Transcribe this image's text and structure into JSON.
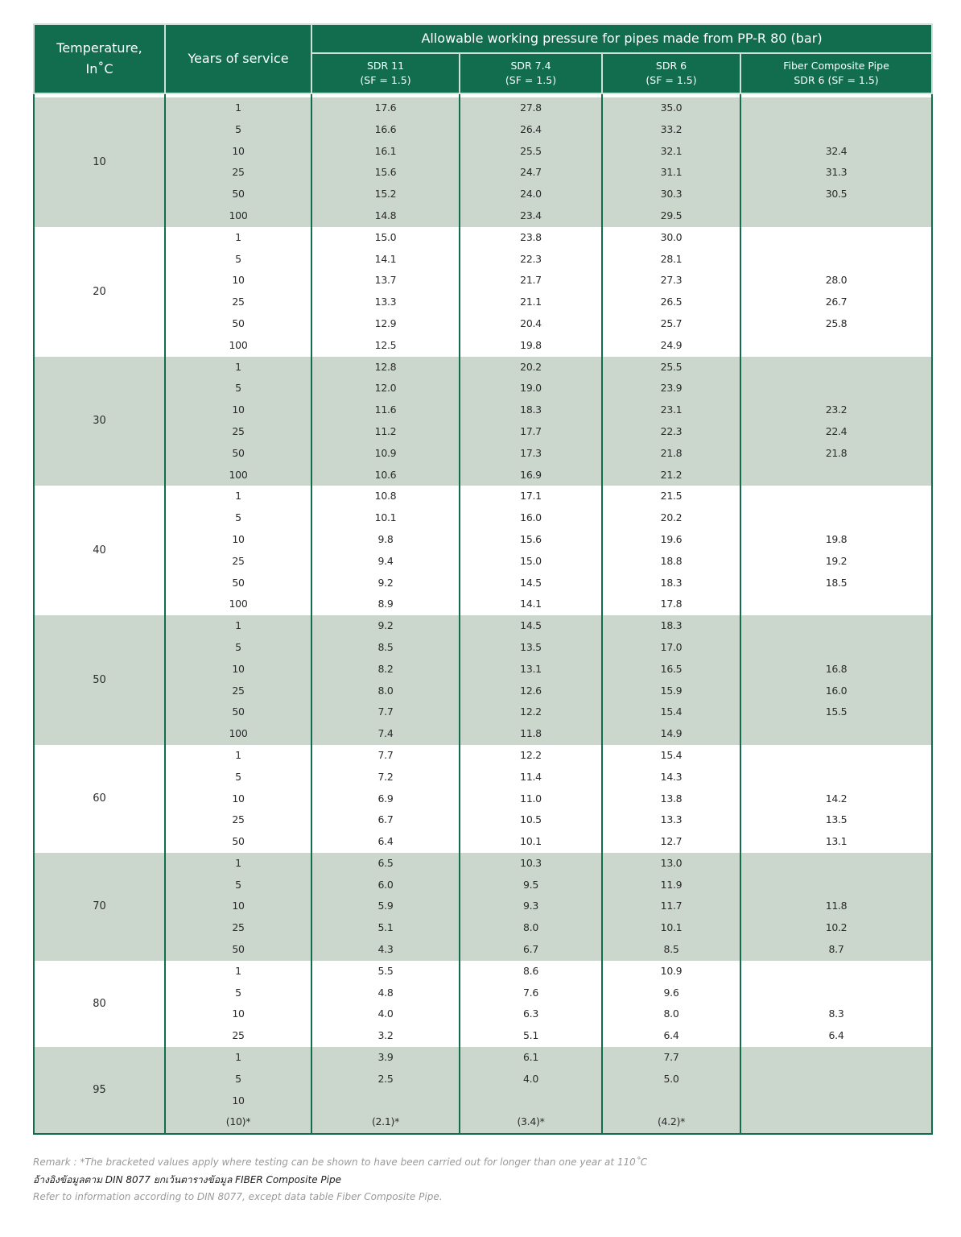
{
  "header": {
    "temperature_label_line1": "Temperature,",
    "temperature_label_line2": "In˚C",
    "years_label": "Years of service",
    "group_title": "Allowable working pressure for pipes made from PP-R 80 (bar)",
    "columns": [
      {
        "line1": "SDR 11",
        "line2": "(SF = 1.5)"
      },
      {
        "line1": "SDR 7.4",
        "line2": "(SF = 1.5)"
      },
      {
        "line1": "SDR 6",
        "line2": "(SF = 1.5)"
      },
      {
        "line1": "Fiber Composite Pipe",
        "line2": "SDR 6 (SF = 1.5)"
      }
    ]
  },
  "colors": {
    "header_green": "#116d4e",
    "row_shade": "#cbd7cd"
  },
  "groups": [
    {
      "temp": "10",
      "years": [
        "1",
        "5",
        "10",
        "25",
        "50",
        "100"
      ],
      "sdr11": [
        "17.6",
        "16.6",
        "16.1",
        "15.6",
        "15.2",
        "14.8"
      ],
      "sdr74": [
        "27.8",
        "26.4",
        "25.5",
        "24.7",
        "24.0",
        "23.4"
      ],
      "sdr6": [
        "35.0",
        "33.2",
        "32.1",
        "31.1",
        "30.3",
        "29.5"
      ],
      "fiber": [
        "",
        "",
        "32.4",
        "31.3",
        "30.5",
        ""
      ]
    },
    {
      "temp": "20",
      "years": [
        "1",
        "5",
        "10",
        "25",
        "50",
        "100"
      ],
      "sdr11": [
        "15.0",
        "14.1",
        "13.7",
        "13.3",
        "12.9",
        "12.5"
      ],
      "sdr74": [
        "23.8",
        "22.3",
        "21.7",
        "21.1",
        "20.4",
        "19.8"
      ],
      "sdr6": [
        "30.0",
        "28.1",
        "27.3",
        "26.5",
        "25.7",
        "24.9"
      ],
      "fiber": [
        "",
        "",
        "28.0",
        "26.7",
        "25.8",
        ""
      ]
    },
    {
      "temp": "30",
      "years": [
        "1",
        "5",
        "10",
        "25",
        "50",
        "100"
      ],
      "sdr11": [
        "12.8",
        "12.0",
        "11.6",
        "11.2",
        "10.9",
        "10.6"
      ],
      "sdr74": [
        "20.2",
        "19.0",
        "18.3",
        "17.7",
        "17.3",
        "16.9"
      ],
      "sdr6": [
        "25.5",
        "23.9",
        "23.1",
        "22.3",
        "21.8",
        "21.2"
      ],
      "fiber": [
        "",
        "",
        "23.2",
        "22.4",
        "21.8",
        ""
      ]
    },
    {
      "temp": "40",
      "years": [
        "1",
        "5",
        "10",
        "25",
        "50",
        "100"
      ],
      "sdr11": [
        "10.8",
        "10.1",
        "9.8",
        "9.4",
        "9.2",
        "8.9"
      ],
      "sdr74": [
        "17.1",
        "16.0",
        "15.6",
        "15.0",
        "14.5",
        "14.1"
      ],
      "sdr6": [
        "21.5",
        "20.2",
        "19.6",
        "18.8",
        "18.3",
        "17.8"
      ],
      "fiber": [
        "",
        "",
        "19.8",
        "19.2",
        "18.5",
        ""
      ]
    },
    {
      "temp": "50",
      "years": [
        "1",
        "5",
        "10",
        "25",
        "50",
        "100"
      ],
      "sdr11": [
        "9.2",
        "8.5",
        "8.2",
        "8.0",
        "7.7",
        "7.4"
      ],
      "sdr74": [
        "14.5",
        "13.5",
        "13.1",
        "12.6",
        "12.2",
        "11.8"
      ],
      "sdr6": [
        "18.3",
        "17.0",
        "16.5",
        "15.9",
        "15.4",
        "14.9"
      ],
      "fiber": [
        "",
        "",
        "16.8",
        "16.0",
        "15.5",
        ""
      ]
    },
    {
      "temp": "60",
      "years": [
        "1",
        "5",
        "10",
        "25",
        "50"
      ],
      "sdr11": [
        "7.7",
        "7.2",
        "6.9",
        "6.7",
        "6.4"
      ],
      "sdr74": [
        "12.2",
        "11.4",
        "11.0",
        "10.5",
        "10.1"
      ],
      "sdr6": [
        "15.4",
        "14.3",
        "13.8",
        "13.3",
        "12.7"
      ],
      "fiber": [
        "",
        "",
        "14.2",
        "13.5",
        "13.1"
      ]
    },
    {
      "temp": "70",
      "years": [
        "1",
        "5",
        "10",
        "25",
        "50"
      ],
      "sdr11": [
        "6.5",
        "6.0",
        "5.9",
        "5.1",
        "4.3"
      ],
      "sdr74": [
        "10.3",
        "9.5",
        "9.3",
        "8.0",
        "6.7"
      ],
      "sdr6": [
        "13.0",
        "11.9",
        "11.7",
        "10.1",
        "8.5"
      ],
      "fiber": [
        "",
        "",
        "11.8",
        "10.2",
        "8.7"
      ]
    },
    {
      "temp": "80",
      "years": [
        "1",
        "5",
        "10",
        "25"
      ],
      "sdr11": [
        "5.5",
        "4.8",
        "4.0",
        "3.2"
      ],
      "sdr74": [
        "8.6",
        "7.6",
        "6.3",
        "5.1"
      ],
      "sdr6": [
        "10.9",
        "9.6",
        "8.0",
        "6.4"
      ],
      "fiber": [
        "",
        "",
        "8.3",
        "6.4"
      ]
    },
    {
      "temp": "95",
      "years": [
        "1",
        "5",
        "10",
        "(10)*"
      ],
      "sdr11": [
        "3.9",
        "2.5",
        "",
        "(2.1)*"
      ],
      "sdr74": [
        "6.1",
        "4.0",
        "",
        "(3.4)*"
      ],
      "sdr6": [
        "7.7",
        "5.0",
        "",
        "(4.2)*"
      ],
      "fiber": [
        "",
        "",
        "",
        ""
      ]
    }
  ],
  "remarks": {
    "line1": "Remark : *The bracketed values apply where testing can be shown to have been carried out for longer than one year at 110˚C",
    "line2": "อ้างอิงข้อมูลตาม DIN 8077 ยกเว้นตารางข้อมูล FIBER Composite Pipe",
    "line3": "Refer to information according to DIN 8077, except data table Fiber Composite Pipe."
  }
}
